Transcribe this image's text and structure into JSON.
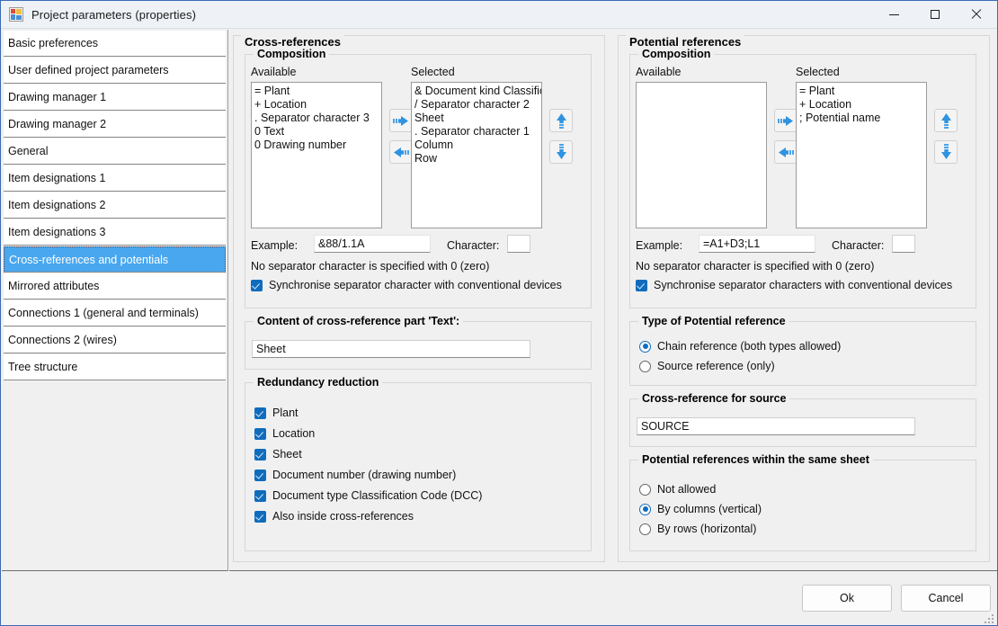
{
  "window": {
    "title": "Project parameters (properties)",
    "icon": "properties-window-icon",
    "minimize": "—",
    "maximize": "□",
    "close": "✕"
  },
  "sidebar": {
    "items": [
      {
        "label": "Basic preferences",
        "selected": false
      },
      {
        "label": "User defined project parameters",
        "selected": false
      },
      {
        "label": "Drawing manager 1",
        "selected": false
      },
      {
        "label": "Drawing manager 2",
        "selected": false
      },
      {
        "label": "General",
        "selected": false
      },
      {
        "label": "Item designations 1",
        "selected": false
      },
      {
        "label": "Item designations 2",
        "selected": false
      },
      {
        "label": "Item designations 3",
        "selected": false
      },
      {
        "label": "Cross-references and potentials",
        "selected": true
      },
      {
        "label": "Mirrored attributes",
        "selected": false
      },
      {
        "label": "Connections 1 (general and terminals)",
        "selected": false
      },
      {
        "label": "Connections 2 (wires)",
        "selected": false
      },
      {
        "label": "Tree structure",
        "selected": false
      }
    ]
  },
  "cross_references": {
    "group_title": "Cross-references",
    "composition": {
      "title": "Composition",
      "available_label": "Available",
      "selected_label": "Selected",
      "available_items": [
        "= Plant",
        "+ Location",
        ". Separator character 3",
        "0 Text",
        "0 Drawing number"
      ],
      "selected_items": [
        "& Document kind Classificati",
        "/ Separator character 2",
        "Sheet",
        ". Separator character 1",
        "Column",
        "Row"
      ],
      "move_right_icon": "arrow-right-icon",
      "move_left_icon": "arrow-left-icon",
      "move_up_icon": "arrow-up-icon",
      "move_down_icon": "arrow-down-icon",
      "example_label": "Example:",
      "example_value": "&88/1.1A",
      "character_label": "Character:",
      "character_value": "",
      "hint": "No separator character is specified with 0 (zero)",
      "sync_checkbox_label": "Synchronise separator character with conventional devices",
      "sync_checked": true
    },
    "text_part": {
      "title": "Content of cross-reference part 'Text':",
      "value": "Sheet"
    },
    "redundancy": {
      "title": "Redundancy reduction",
      "items": [
        {
          "label": "Plant",
          "checked": true
        },
        {
          "label": "Location",
          "checked": true
        },
        {
          "label": "Sheet",
          "checked": true
        },
        {
          "label": "Document number (drawing number)",
          "checked": true
        },
        {
          "label": "Document type Classification Code (DCC)",
          "checked": true
        },
        {
          "label": "Also inside cross-references",
          "checked": true
        }
      ]
    }
  },
  "potential_references": {
    "group_title": "Potential references",
    "composition": {
      "title": "Composition",
      "available_label": "Available",
      "selected_label": "Selected",
      "available_items": [],
      "selected_items": [
        "= Plant",
        "+ Location",
        "; Potential name"
      ],
      "move_right_icon": "arrow-right-icon",
      "move_left_icon": "arrow-left-icon",
      "move_up_icon": "arrow-up-icon",
      "move_down_icon": "arrow-down-icon",
      "example_label": "Example:",
      "example_value": "=A1+D3;L1",
      "character_label": "Character:",
      "character_value": "",
      "hint": "No separator character is specified with 0 (zero)",
      "sync_checkbox_label": "Synchronise separator characters with conventional devices",
      "sync_checked": true
    },
    "type": {
      "title": "Type of Potential reference",
      "options": [
        {
          "label": "Chain reference (both types allowed)",
          "selected": true
        },
        {
          "label": "Source reference (only)",
          "selected": false
        }
      ]
    },
    "source": {
      "title": "Cross-reference for source",
      "value": "SOURCE"
    },
    "same_sheet": {
      "title": "Potential references within the same sheet",
      "options": [
        {
          "label": "Not allowed",
          "selected": false
        },
        {
          "label": "By columns (vertical)",
          "selected": true
        },
        {
          "label": "By rows (horizontal)",
          "selected": false
        }
      ]
    }
  },
  "footer": {
    "ok_label": "Ok",
    "cancel_label": "Cancel"
  },
  "colors": {
    "accent": "#0f6cbd",
    "selection": "#49a7ef",
    "arrow_blue": "#4aa3e8",
    "titlebar": "#eef2f7",
    "window_border": "#3b6ab5"
  }
}
